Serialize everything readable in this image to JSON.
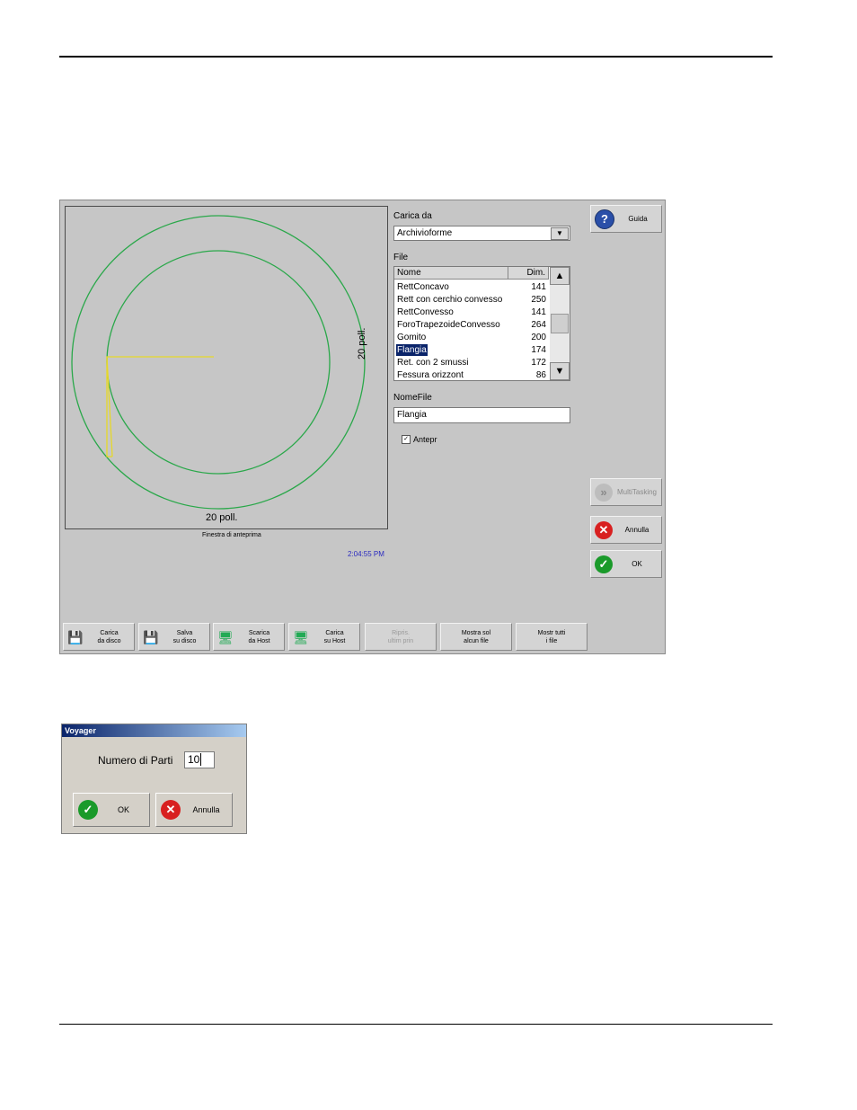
{
  "screen": {
    "preview": {
      "dim_bottom": "20 poll.",
      "dim_right": "20 poll.",
      "caption": "Finestra di anteprima",
      "outer_circle_color": "#2aa84a",
      "path_color": "#e6d82a"
    },
    "clock": "2:04:55 PM",
    "load_from": {
      "label": "Carica da",
      "value": "Archivioforme"
    },
    "file": {
      "label": "File",
      "columns": [
        "Nome",
        "Dim."
      ],
      "rows": [
        {
          "name": "RettConcavo",
          "dim": "141"
        },
        {
          "name": "Rett con cerchio convesso",
          "dim": "250"
        },
        {
          "name": "RettConvesso",
          "dim": "141"
        },
        {
          "name": "ForoTrapezoideConvesso",
          "dim": "264"
        },
        {
          "name": "Gomito",
          "dim": "200"
        },
        {
          "name": "Flangia",
          "dim": "174",
          "selected": true
        },
        {
          "name": "Ret. con 2 smussi",
          "dim": "172"
        },
        {
          "name": "Fessura orizzont",
          "dim": "86"
        }
      ]
    },
    "filename": {
      "label": "NomeFile",
      "value": "Flangia"
    },
    "preview_check": {
      "label": "Antepr",
      "checked": true
    },
    "side_buttons": {
      "help": "Guida",
      "multitasking": "MultiTasking",
      "cancel": "Annulla",
      "ok": "OK"
    },
    "bottom_buttons": [
      {
        "label": "Carica\nda disco",
        "enabled": true
      },
      {
        "label": "Salva\nsu disco",
        "enabled": true
      },
      {
        "label": "Scarica\nda Host",
        "enabled": true
      },
      {
        "label": "Carica\nsu Host",
        "enabled": true
      },
      {
        "label": "Ripris.\nultim prin",
        "enabled": false
      },
      {
        "label": "Mostra sol\nalcun file",
        "enabled": true
      },
      {
        "label": "Mostr tutti\ni file",
        "enabled": true
      }
    ]
  },
  "dialog": {
    "title": "Voyager",
    "label": "Numero di Parti",
    "value": "10",
    "ok": "OK",
    "cancel": "Annulla"
  }
}
